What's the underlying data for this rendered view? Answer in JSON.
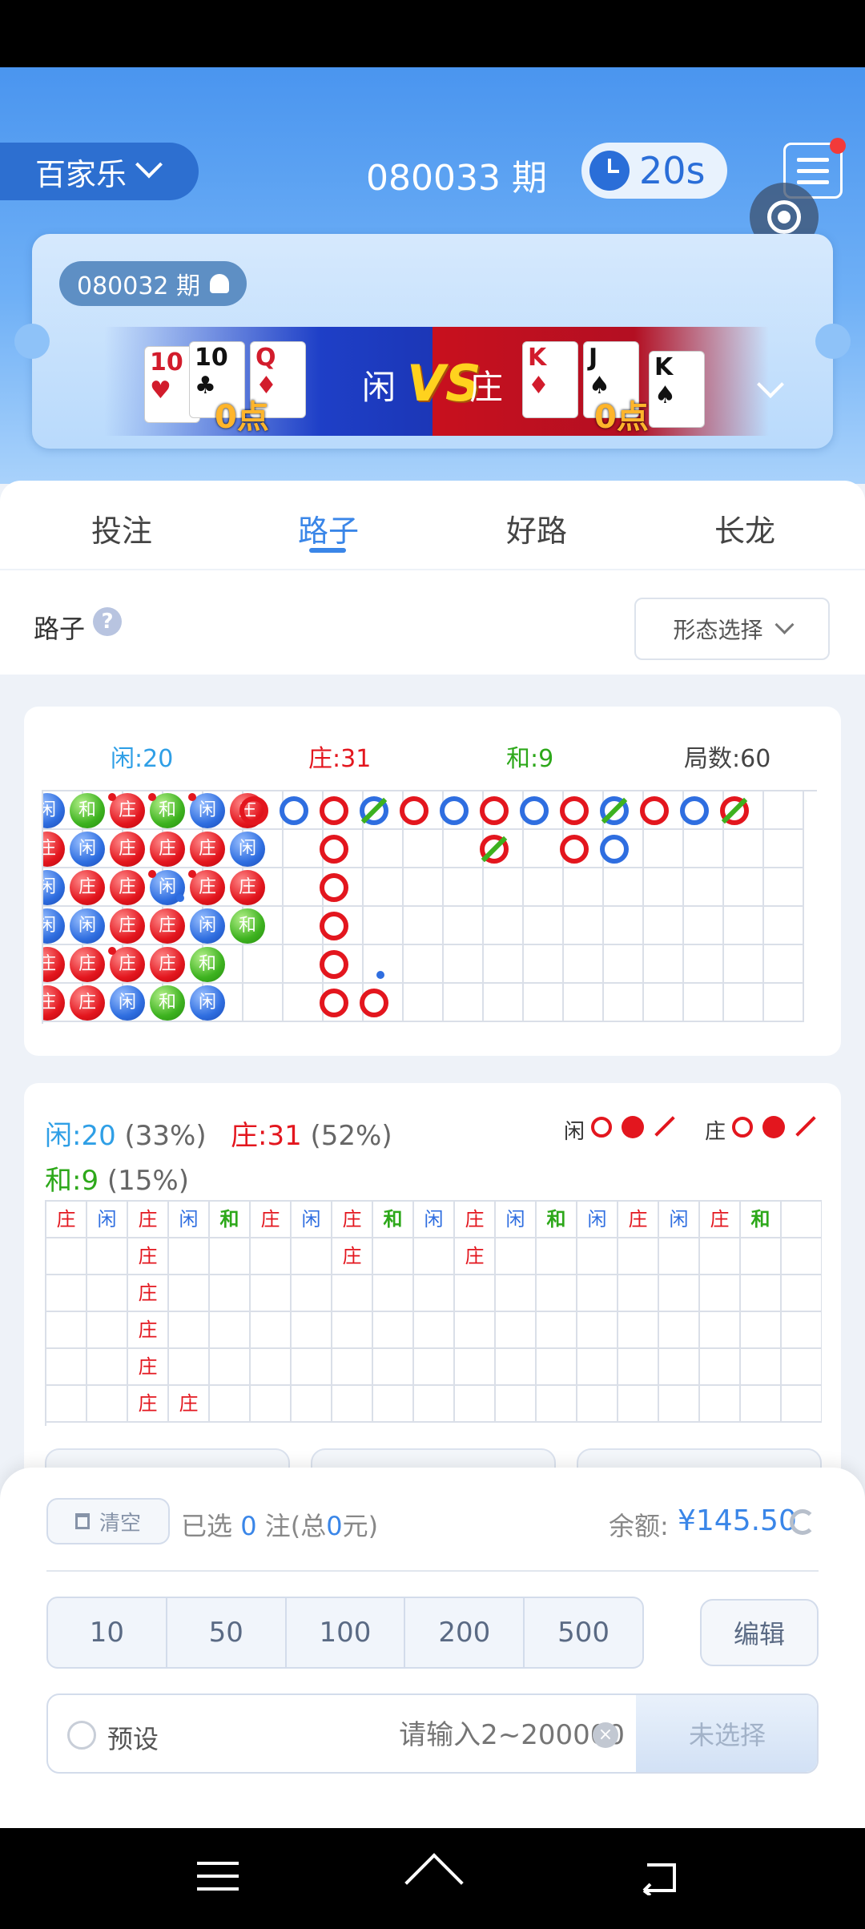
{
  "header": {
    "game_name": "百家乐",
    "current_period": "080033 期",
    "countdown": "20s"
  },
  "last_result": {
    "period": "080032 期",
    "player_label": "闲",
    "banker_label": "庄",
    "vs": "VS",
    "player_points": "0点",
    "banker_points": "0点",
    "player_cards": [
      {
        "rank": "10",
        "suit": "♥",
        "color": "red"
      },
      {
        "rank": "10",
        "suit": "♣",
        "color": "black"
      },
      {
        "rank": "Q",
        "suit": "♦",
        "color": "red"
      }
    ],
    "banker_cards": [
      {
        "rank": "K",
        "suit": "♦",
        "color": "red"
      },
      {
        "rank": "J",
        "suit": "♠",
        "color": "black"
      },
      {
        "rank": "K",
        "suit": "♠",
        "color": "black"
      }
    ]
  },
  "tabs": [
    "投注",
    "路子",
    "好路",
    "长龙"
  ],
  "active_tab": 1,
  "roads": {
    "title": "路子",
    "help": "?",
    "shape_select": "形态选择"
  },
  "big_road": {
    "stats": {
      "player": "闲:20",
      "banker": "庄:31",
      "tie": "和:9",
      "rounds": "局数:60"
    },
    "ball_labels": {
      "player": "闲",
      "banker": "庄",
      "tie": "和"
    },
    "bead_columns": [
      [
        "p",
        "b",
        "p",
        "p",
        "b",
        "b"
      ],
      [
        "t",
        "p",
        "b",
        "p",
        "b",
        "b"
      ],
      [
        "b",
        "b",
        "b",
        "b",
        "b",
        "p"
      ],
      [
        "t",
        "b",
        "p",
        "b",
        "b",
        "t"
      ],
      [
        "p",
        "b",
        "b",
        "p",
        "t",
        "p"
      ],
      [
        "b",
        "p",
        "b",
        "t",
        "",
        ""
      ]
    ]
  },
  "bead_plate": {
    "player_stat": "闲:20",
    "player_pct": "(33%)",
    "banker_stat": "庄:31",
    "banker_pct": "(52%)",
    "tie_stat": "和:9",
    "tie_pct": "(15%)",
    "legend_player": "闲",
    "legend_banker": "庄",
    "rows": [
      [
        "庄",
        "闲",
        "庄",
        "闲",
        "和",
        "庄",
        "闲",
        "庄",
        "和",
        "闲",
        "庄",
        "闲",
        "和",
        "闲",
        "庄",
        "闲",
        "庄",
        "和",
        ""
      ],
      [
        "",
        "",
        "庄",
        "",
        "",
        "",
        "",
        "庄",
        "",
        "",
        "庄",
        "",
        "",
        "",
        "",
        "",
        "",
        "",
        ""
      ],
      [
        "",
        "",
        "庄",
        "",
        "",
        "",
        "",
        "",
        "",
        "",
        "",
        "",
        "",
        "",
        "",
        "",
        "",
        "",
        ""
      ],
      [
        "",
        "",
        "庄",
        "",
        "",
        "",
        "",
        "",
        "",
        "",
        "",
        "",
        "",
        "",
        "",
        "",
        "",
        "",
        ""
      ],
      [
        "",
        "",
        "庄",
        "",
        "",
        "",
        "",
        "",
        "",
        "",
        "",
        "",
        "",
        "",
        "",
        "",
        "",
        "",
        ""
      ],
      [
        "",
        "",
        "庄",
        "庄",
        "",
        "",
        "",
        "",
        "",
        "",
        "",
        "",
        "",
        "",
        "",
        "",
        "",
        "",
        ""
      ]
    ]
  },
  "betting": {
    "clear_label": "清空",
    "selected_prefix": "已选",
    "selected_count": "0",
    "selected_mid": "注(总",
    "selected_total": "0",
    "selected_suffix": "元)",
    "balance_label": "余额:",
    "balance_value": "¥145.50",
    "chips": [
      "10",
      "50",
      "100",
      "200",
      "500"
    ],
    "edit_label": "编辑",
    "preset_label": "预设",
    "amount_placeholder": "请输入2~200000",
    "submit_label": "未选择"
  },
  "colors": {
    "player": "#2f6ee0",
    "banker": "#e3161e",
    "tie": "#3db21f",
    "accent": "#3a86e8"
  }
}
